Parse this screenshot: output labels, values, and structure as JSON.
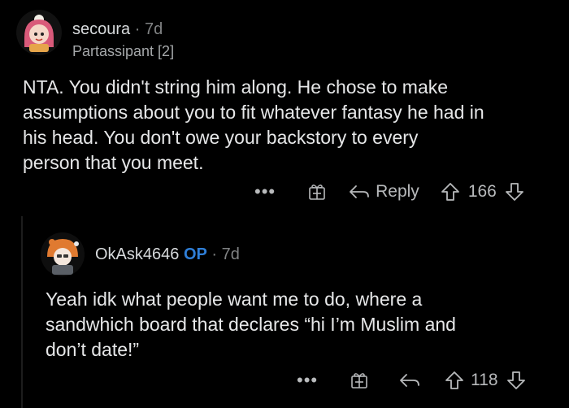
{
  "comments": [
    {
      "username": "secoura",
      "time": "7d",
      "flair": "Partassipant [2]",
      "body": [
        "NTA. You didn't string him along. He chose to make",
        "assumptions about you to fit whatever fantasy he had in",
        "his head. You don't owe  your backstory to every",
        "person that you meet."
      ],
      "more": "•••",
      "reply_label": "Reply",
      "votes": "166"
    },
    {
      "username": "OkAsk4646",
      "op_badge": "OP",
      "time": "7d",
      "body": [
        "Yeah idk what people want me to do, where a",
        "sandwhich board that declares “hi I’m Muslim and",
        "don’t date!”"
      ],
      "more": "•••",
      "votes": "118"
    }
  ],
  "separator": "·",
  "icons": [
    "avatar",
    "award-icon",
    "reply-arrow-icon",
    "upvote-icon",
    "downvote-icon",
    "more-options-icon"
  ]
}
